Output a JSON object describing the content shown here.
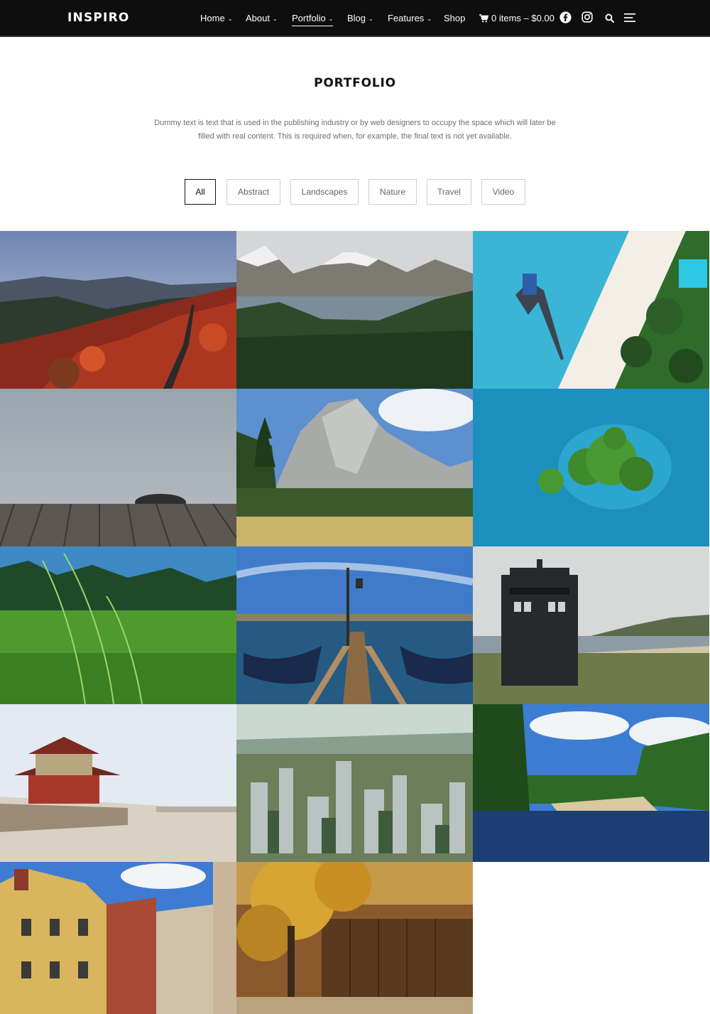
{
  "header": {
    "logo": "INSPIRO",
    "nav": [
      {
        "label": "Home",
        "has_menu": true
      },
      {
        "label": "About",
        "has_menu": true
      },
      {
        "label": "Portfolio",
        "has_menu": true,
        "active": true
      },
      {
        "label": "Blog",
        "has_menu": true
      },
      {
        "label": "Features",
        "has_menu": true
      },
      {
        "label": "Shop",
        "has_menu": false
      }
    ],
    "cart_label": "0 items – $0.00",
    "icons": [
      "cart-icon",
      "facebook-icon",
      "instagram-icon",
      "search-icon",
      "menu-icon"
    ],
    "chevron_glyph": "⌄"
  },
  "page": {
    "title": "PORTFOLIO",
    "intro": "Dummy text is text that is used in the publishing industry or by web designers to occupy the space which will later be filled with real content. This is required when, for example, the final text is not yet available."
  },
  "filters": {
    "items": [
      "All",
      "Abstract",
      "Landscapes",
      "Nature",
      "Travel",
      "Video"
    ],
    "selected": "All"
  },
  "portfolio": {
    "items": [
      {
        "subject": "autumn-road"
      },
      {
        "subject": "mountain-lake"
      },
      {
        "subject": "tropical-beach"
      },
      {
        "subject": "foggy-pier"
      },
      {
        "subject": "granite-cliff"
      },
      {
        "subject": "island-aerial"
      },
      {
        "subject": "grass-closeup"
      },
      {
        "subject": "venice-pier"
      },
      {
        "subject": "police-box"
      },
      {
        "subject": "great-wall"
      },
      {
        "subject": "city-skyline"
      },
      {
        "subject": "forest-river"
      },
      {
        "subject": "old-town-buildings"
      },
      {
        "subject": "autumn-tree-house"
      }
    ]
  },
  "colors": {
    "header_bg": "#0e0e0e",
    "text_dark": "#111111",
    "text_muted": "#6e6e6e",
    "border": "#cfcfcf"
  }
}
